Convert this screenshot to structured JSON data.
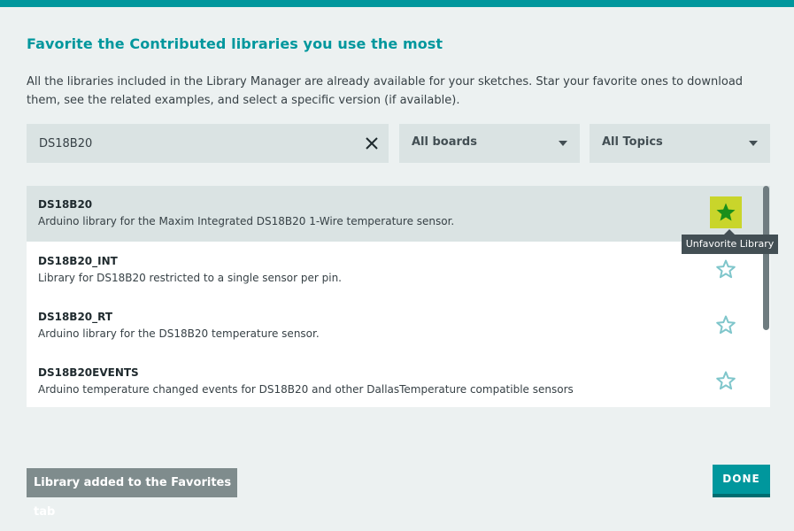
{
  "dialog": {
    "title": "Favorite the Contributed libraries you use the most",
    "description": "All the libraries included in the Library Manager are already available for your sketches. Star your favorite ones to download them, see the related examples, and select a specific version (if available)."
  },
  "filters": {
    "search_value": "DS18B20",
    "boards_selected": "All boards",
    "topics_selected": "All Topics"
  },
  "libraries": [
    {
      "name": "DS18B20",
      "description": "Arduino library for the Maxim Integrated DS18B20 1-Wire temperature sensor.",
      "favorite": true
    },
    {
      "name": "DS18B20_INT",
      "description": "Library for DS18B20 restricted to a single sensor per pin.",
      "favorite": false
    },
    {
      "name": "DS18B20_RT",
      "description": "Arduino library for the DS18B20 temperature sensor.",
      "favorite": false
    },
    {
      "name": "DS18B20EVENTS",
      "description": "Arduino temperature changed events for DS18B20 and other DallasTemperature compatible sensors",
      "favorite": false
    }
  ],
  "tooltip": "Unfavorite Library",
  "toast": "Library added to the Favorites tab",
  "done_label": "DONE",
  "icons": {
    "clear": "close-icon",
    "dropdown": "chevron-down-icon",
    "favorite_on": "star-filled-icon",
    "favorite_off": "star-outline-icon"
  },
  "colors": {
    "accent": "#00979d",
    "star_filled": "#1a8f1a",
    "star_outline": "#7fc6cb",
    "star_highlight": "#c9d52b"
  }
}
